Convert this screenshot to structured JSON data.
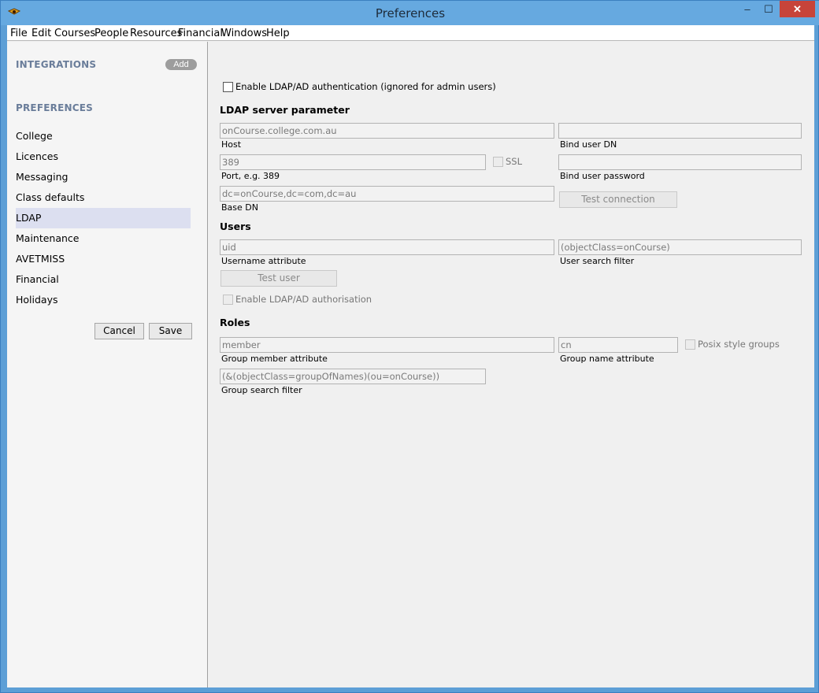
{
  "window": {
    "title": "Preferences"
  },
  "menu": [
    "File",
    "Edit",
    "Courses",
    "People",
    "Resources",
    "Financial",
    "Windows",
    "Help"
  ],
  "sidebar": {
    "integrations_heading": "INTEGRATIONS",
    "add_label": "Add",
    "preferences_heading": "PREFERENCES",
    "items": [
      "College",
      "Licences",
      "Messaging",
      "Class defaults",
      "LDAP",
      "Maintenance",
      "AVETMISS",
      "Financial",
      "Holidays"
    ],
    "active_item": "LDAP",
    "cancel_label": "Cancel",
    "save_label": "Save"
  },
  "ldap": {
    "enable_auth_label": "Enable LDAP/AD authentication (ignored for admin users)",
    "server_section": "LDAP server parameter",
    "host_value": "onCourse.college.com.au",
    "host_label": "Host",
    "bind_dn_value": "",
    "bind_dn_label": "Bind user DN",
    "port_value": "389",
    "port_label": "Port, e.g. 389",
    "ssl_label": "SSL",
    "bind_password_value": "",
    "bind_password_label": "Bind user password",
    "base_dn_value": "dc=onCourse,dc=com,dc=au",
    "base_dn_label": "Base DN",
    "test_connection_label": "Test connection",
    "users_section": "Users",
    "username_attr_value": "uid",
    "username_attr_label": "Username attribute",
    "user_filter_value": "(objectClass=onCourse)",
    "user_filter_label": "User search filter",
    "test_user_label": "Test user",
    "enable_authorisation_label": "Enable LDAP/AD authorisation",
    "roles_section": "Roles",
    "group_member_value": "member",
    "group_member_label": "Group member attribute",
    "group_name_value": "cn",
    "group_name_label": "Group name attribute",
    "posix_label": "Posix style groups",
    "group_filter_value": "(&(objectClass=groupOfNames)(ou=onCourse))",
    "group_filter_label": "Group search filter"
  }
}
